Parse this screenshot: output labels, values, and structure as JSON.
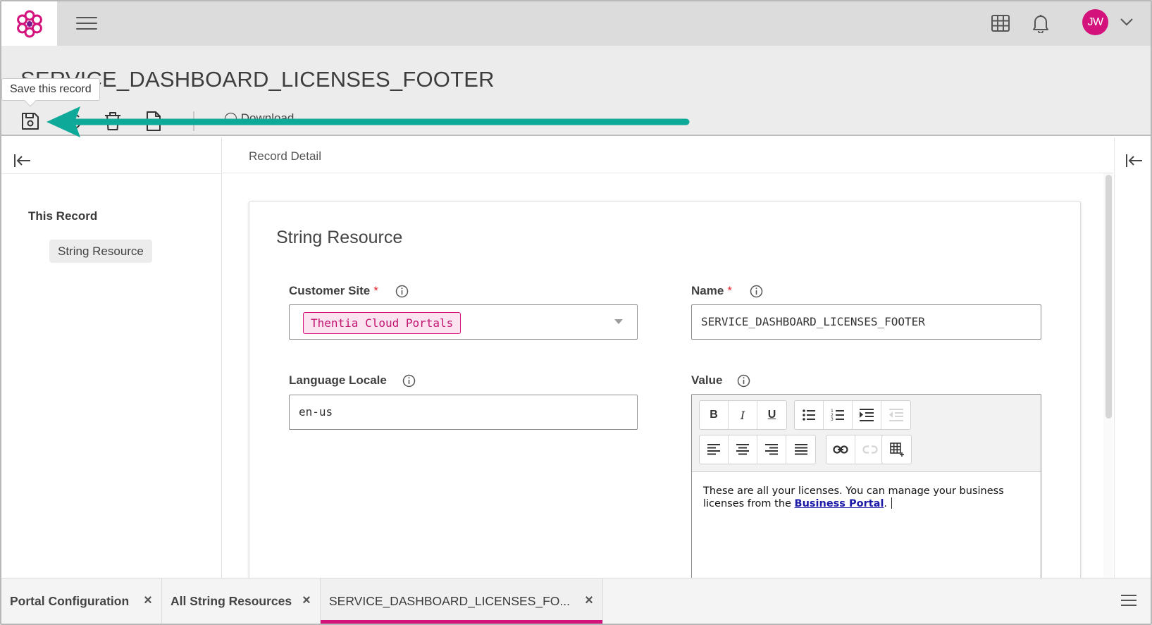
{
  "app": {
    "brand_color": "#d3127c",
    "logo_icon": "flower-logo-icon"
  },
  "topbar": {
    "menu_icon": "hamburger-icon",
    "apps_icon": "grid-icon",
    "notifications_icon": "bell-icon",
    "user_initials": "JW",
    "user_menu_icon": "chevron-down-icon"
  },
  "header": {
    "title": "SERVICE_DASHBOARD_LICENSES_FOOTER",
    "tooltip": "Save this record",
    "toolbar": {
      "save_icon": "save-icon",
      "refresh_icon": "refresh-icon",
      "delete_icon": "trash-icon",
      "copy_icon": "document-icon",
      "download_label": "Download"
    }
  },
  "left_panel": {
    "section_label": "This Record",
    "items": [
      {
        "label": "String Resource"
      }
    ]
  },
  "main": {
    "header_title": "Record Detail",
    "card_title": "String Resource",
    "fields": {
      "customer_site": {
        "label": "Customer Site",
        "required_mark": "*",
        "value": "Thentia Cloud Portals"
      },
      "name": {
        "label": "Name",
        "required_mark": "*",
        "value": "SERVICE_DASHBOARD_LICENSES_FOOTER"
      },
      "language_locale": {
        "label": "Language Locale",
        "value": "en-us"
      },
      "value": {
        "label": "Value",
        "text_before_link": "These are all your licenses. You can manage your business licenses from the ",
        "link_text": "Business Portal",
        "text_after_link": "."
      }
    },
    "editor_toolbar": {
      "bold": "B",
      "italic": "I",
      "underline": "U"
    }
  },
  "bottom_tabs": [
    {
      "label": "Portal Configuration",
      "active": false
    },
    {
      "label": "All String Resources",
      "active": false
    },
    {
      "label": "SERVICE_DASHBOARD_LICENSES_FO...",
      "active": true
    }
  ],
  "arrow_color": "#0fa99a"
}
